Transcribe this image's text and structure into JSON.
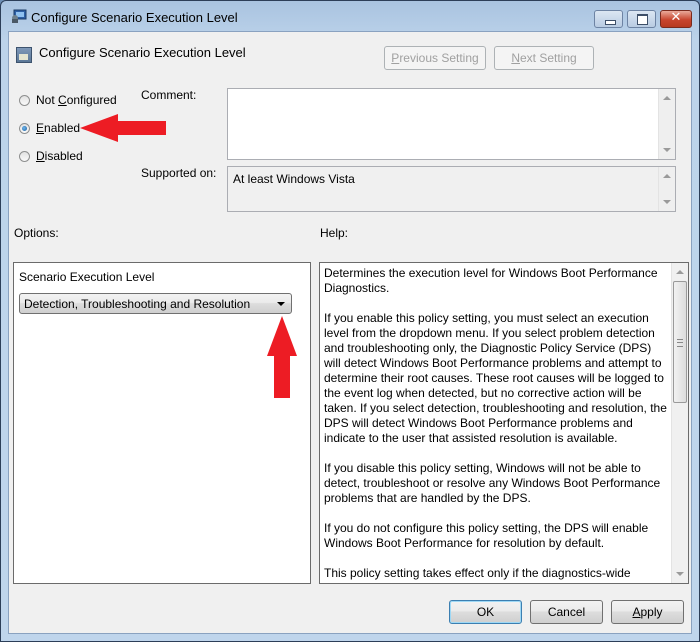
{
  "window": {
    "title": "Configure Scenario Execution Level",
    "controls": {
      "minimize": "minimize",
      "maximize": "maximize",
      "close": "✕"
    }
  },
  "header": {
    "setting_title": "Configure Scenario Execution Level",
    "previous_button": {
      "accel": "P",
      "rest": "revious Setting",
      "enabled": false
    },
    "next_button": {
      "accel": "N",
      "rest": "ext Setting",
      "enabled": false
    }
  },
  "state": {
    "options": [
      {
        "pre": "Not ",
        "accel": "C",
        "post": "onfigured",
        "checked": false
      },
      {
        "pre": "",
        "accel": "E",
        "post": "nabled",
        "checked": true
      },
      {
        "pre": "",
        "accel": "D",
        "post": "isabled",
        "checked": false
      }
    ]
  },
  "comment": {
    "label": "Comment:",
    "value": ""
  },
  "supported": {
    "label": "Supported on:",
    "value": "At least Windows Vista"
  },
  "options_section": {
    "label": "Options:",
    "field_label": "Scenario Execution Level",
    "selected_value": "Detection, Troubleshooting and Resolution"
  },
  "help": {
    "label": "Help:",
    "paragraphs": [
      "Determines the execution level for Windows Boot Performance Diagnostics.",
      "If you enable this policy setting, you must select an execution level from the dropdown menu. If you select problem detection and troubleshooting only, the Diagnostic Policy Service (DPS) will detect Windows Boot Performance problems and attempt to determine their root causes. These root causes will be logged to the event log when detected, but no corrective action will be taken. If you select detection, troubleshooting and resolution, the DPS will detect Windows Boot Performance problems and indicate to the user that assisted resolution is available.",
      "If you disable this policy setting, Windows will not be able to detect, troubleshoot or resolve any Windows Boot Performance problems that are handled by the DPS.",
      "If you do not configure this policy setting, the DPS will enable Windows Boot Performance for resolution by default.",
      "This policy setting takes effect only if the diagnostics-wide"
    ]
  },
  "footer": {
    "ok": "OK",
    "cancel": "Cancel",
    "apply": {
      "accel": "A",
      "rest": "pply"
    }
  },
  "annotations": {
    "arrow_color": "#ed1c24"
  }
}
